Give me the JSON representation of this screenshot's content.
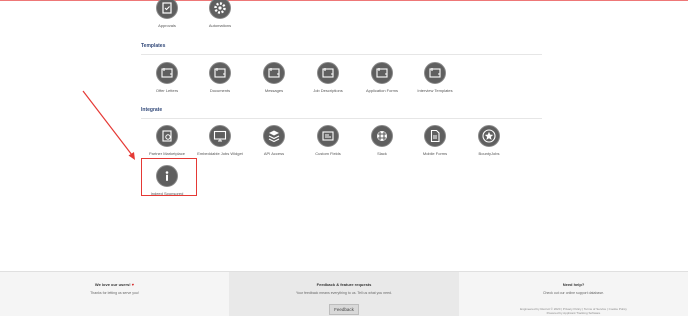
{
  "top_row": [
    {
      "label": "Approvals",
      "icon": "approvals-icon"
    },
    {
      "label": "Automations",
      "icon": "gear-icon"
    }
  ],
  "templates": {
    "title": "Templates",
    "items": [
      {
        "label": "Offer Letters",
        "icon": "template-icon"
      },
      {
        "label": "Documents",
        "icon": "template-icon"
      },
      {
        "label": "Messages",
        "icon": "template-icon"
      },
      {
        "label": "Job Descriptions",
        "icon": "template-icon"
      },
      {
        "label": "Application Forms",
        "icon": "template-icon"
      },
      {
        "label": "Interview Templates",
        "icon": "template-icon"
      }
    ]
  },
  "integrate": {
    "title": "Integrate",
    "items": [
      {
        "label": "Partner Marketplace",
        "icon": "marketplace-icon"
      },
      {
        "label": "Embeddable Jobs Widget",
        "icon": "monitor-icon"
      },
      {
        "label": "API Access",
        "icon": "database-icon"
      },
      {
        "label": "Custom Fields",
        "icon": "fields-icon"
      },
      {
        "label": "Slack",
        "icon": "slack-icon"
      },
      {
        "label": "Mobile Forms",
        "icon": "mobile-forms-icon"
      },
      {
        "label": "BountyJobs",
        "icon": "star-badge-icon"
      },
      {
        "label": "Indeed Sponsored",
        "icon": "info-icon"
      }
    ]
  },
  "footer": {
    "left": {
      "title": "We love our users!",
      "heart": "♥",
      "text": "Thanks for letting us serve you!"
    },
    "middle": {
      "title": "Feedback & feature requests",
      "text": "Your feedback means everything to us. Tell us what you need.",
      "button": "Feedback"
    },
    "right": {
      "title": "Need help?",
      "text": "Check out our online support database.",
      "copyright": "Engineered by Recruit © 2020 | Privacy Policy | Terms of Service | Cookie Policy",
      "powered": "Powered by Applicant Tracking Software"
    }
  },
  "colors": {
    "highlight": "#e53935",
    "arrow": "#e53935",
    "icon_bg": "#5f5f5f",
    "section_title": "#334a7a"
  }
}
